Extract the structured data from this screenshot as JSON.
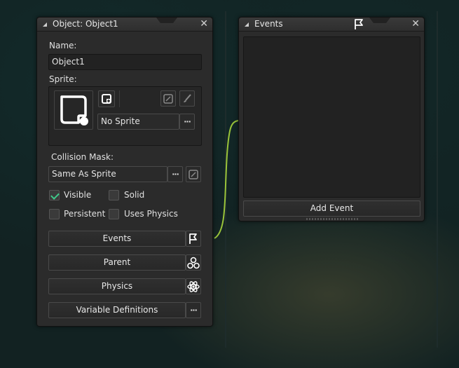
{
  "object_panel": {
    "title": "Object: Object1",
    "name_label": "Name:",
    "name_value": "Object1",
    "sprite_label": "Sprite:",
    "sprite_value": "No Sprite",
    "collision_label": "Collision Mask:",
    "collision_value": "Same As Sprite",
    "checkboxes": [
      {
        "label": "Visible",
        "checked": true
      },
      {
        "label": "Solid",
        "checked": false
      },
      {
        "label": "Persistent",
        "checked": false
      },
      {
        "label": "Uses Physics",
        "checked": false
      }
    ],
    "buttons": {
      "events": "Events",
      "parent": "Parent",
      "physics": "Physics",
      "variables": "Variable Definitions"
    }
  },
  "events_panel": {
    "title": "Events",
    "add_event": "Add Event"
  },
  "colors": {
    "connector": "#9ac43a",
    "check": "#3fc98a",
    "panel_bg": "#2b2b2b"
  }
}
